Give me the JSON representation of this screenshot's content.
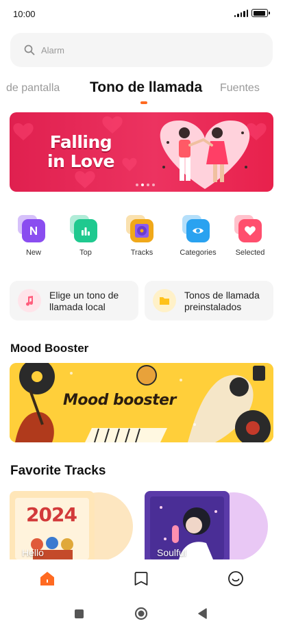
{
  "status": {
    "time": "10:00",
    "battery_level": 0.9
  },
  "search": {
    "placeholder": "Alarm"
  },
  "tabs": [
    {
      "label": "de pantalla",
      "active": false
    },
    {
      "label": "Tono de llamada",
      "active": true
    },
    {
      "label": "Fuentes",
      "active": false
    }
  ],
  "banner": {
    "title_line1": "Falling",
    "title_line2": "in Love",
    "slide_count": 4,
    "active_slide": 2
  },
  "quick_actions": [
    {
      "label": "New",
      "icon": "n-letter-icon",
      "color": "#8a4df0"
    },
    {
      "label": "Top",
      "icon": "bar-chart-icon",
      "color": "#1fc98f"
    },
    {
      "label": "Tracks",
      "icon": "vinyl-record-icon",
      "color": "#f0a81a"
    },
    {
      "label": "Categories",
      "icon": "eye-icon",
      "color": "#2aa2f0"
    },
    {
      "label": "Selected",
      "icon": "heart-icon",
      "color": "#ff4f6e"
    }
  ],
  "shortcuts": [
    {
      "label": "Elige un tono de llamada local",
      "icon": "music-note-icon",
      "color": "#ff5c7c"
    },
    {
      "label": "Tonos de llamada preinstalados",
      "icon": "folder-icon",
      "color": "#ffc21a"
    }
  ],
  "sections": {
    "mood": "Mood Booster",
    "favorites": "Favorite Tracks"
  },
  "mood_banner": {
    "text": "Mood booster"
  },
  "tracks": [
    {
      "label": "Hello",
      "cover_text": "2024"
    },
    {
      "label": "Soulful"
    }
  ],
  "bottom_nav": [
    {
      "name": "home",
      "icon": "home-icon",
      "active": true
    },
    {
      "name": "bookmark",
      "icon": "bookmark-icon",
      "active": false
    },
    {
      "name": "profile",
      "icon": "smiley-icon",
      "active": false
    }
  ],
  "colors": {
    "accent": "#ff6a21"
  }
}
